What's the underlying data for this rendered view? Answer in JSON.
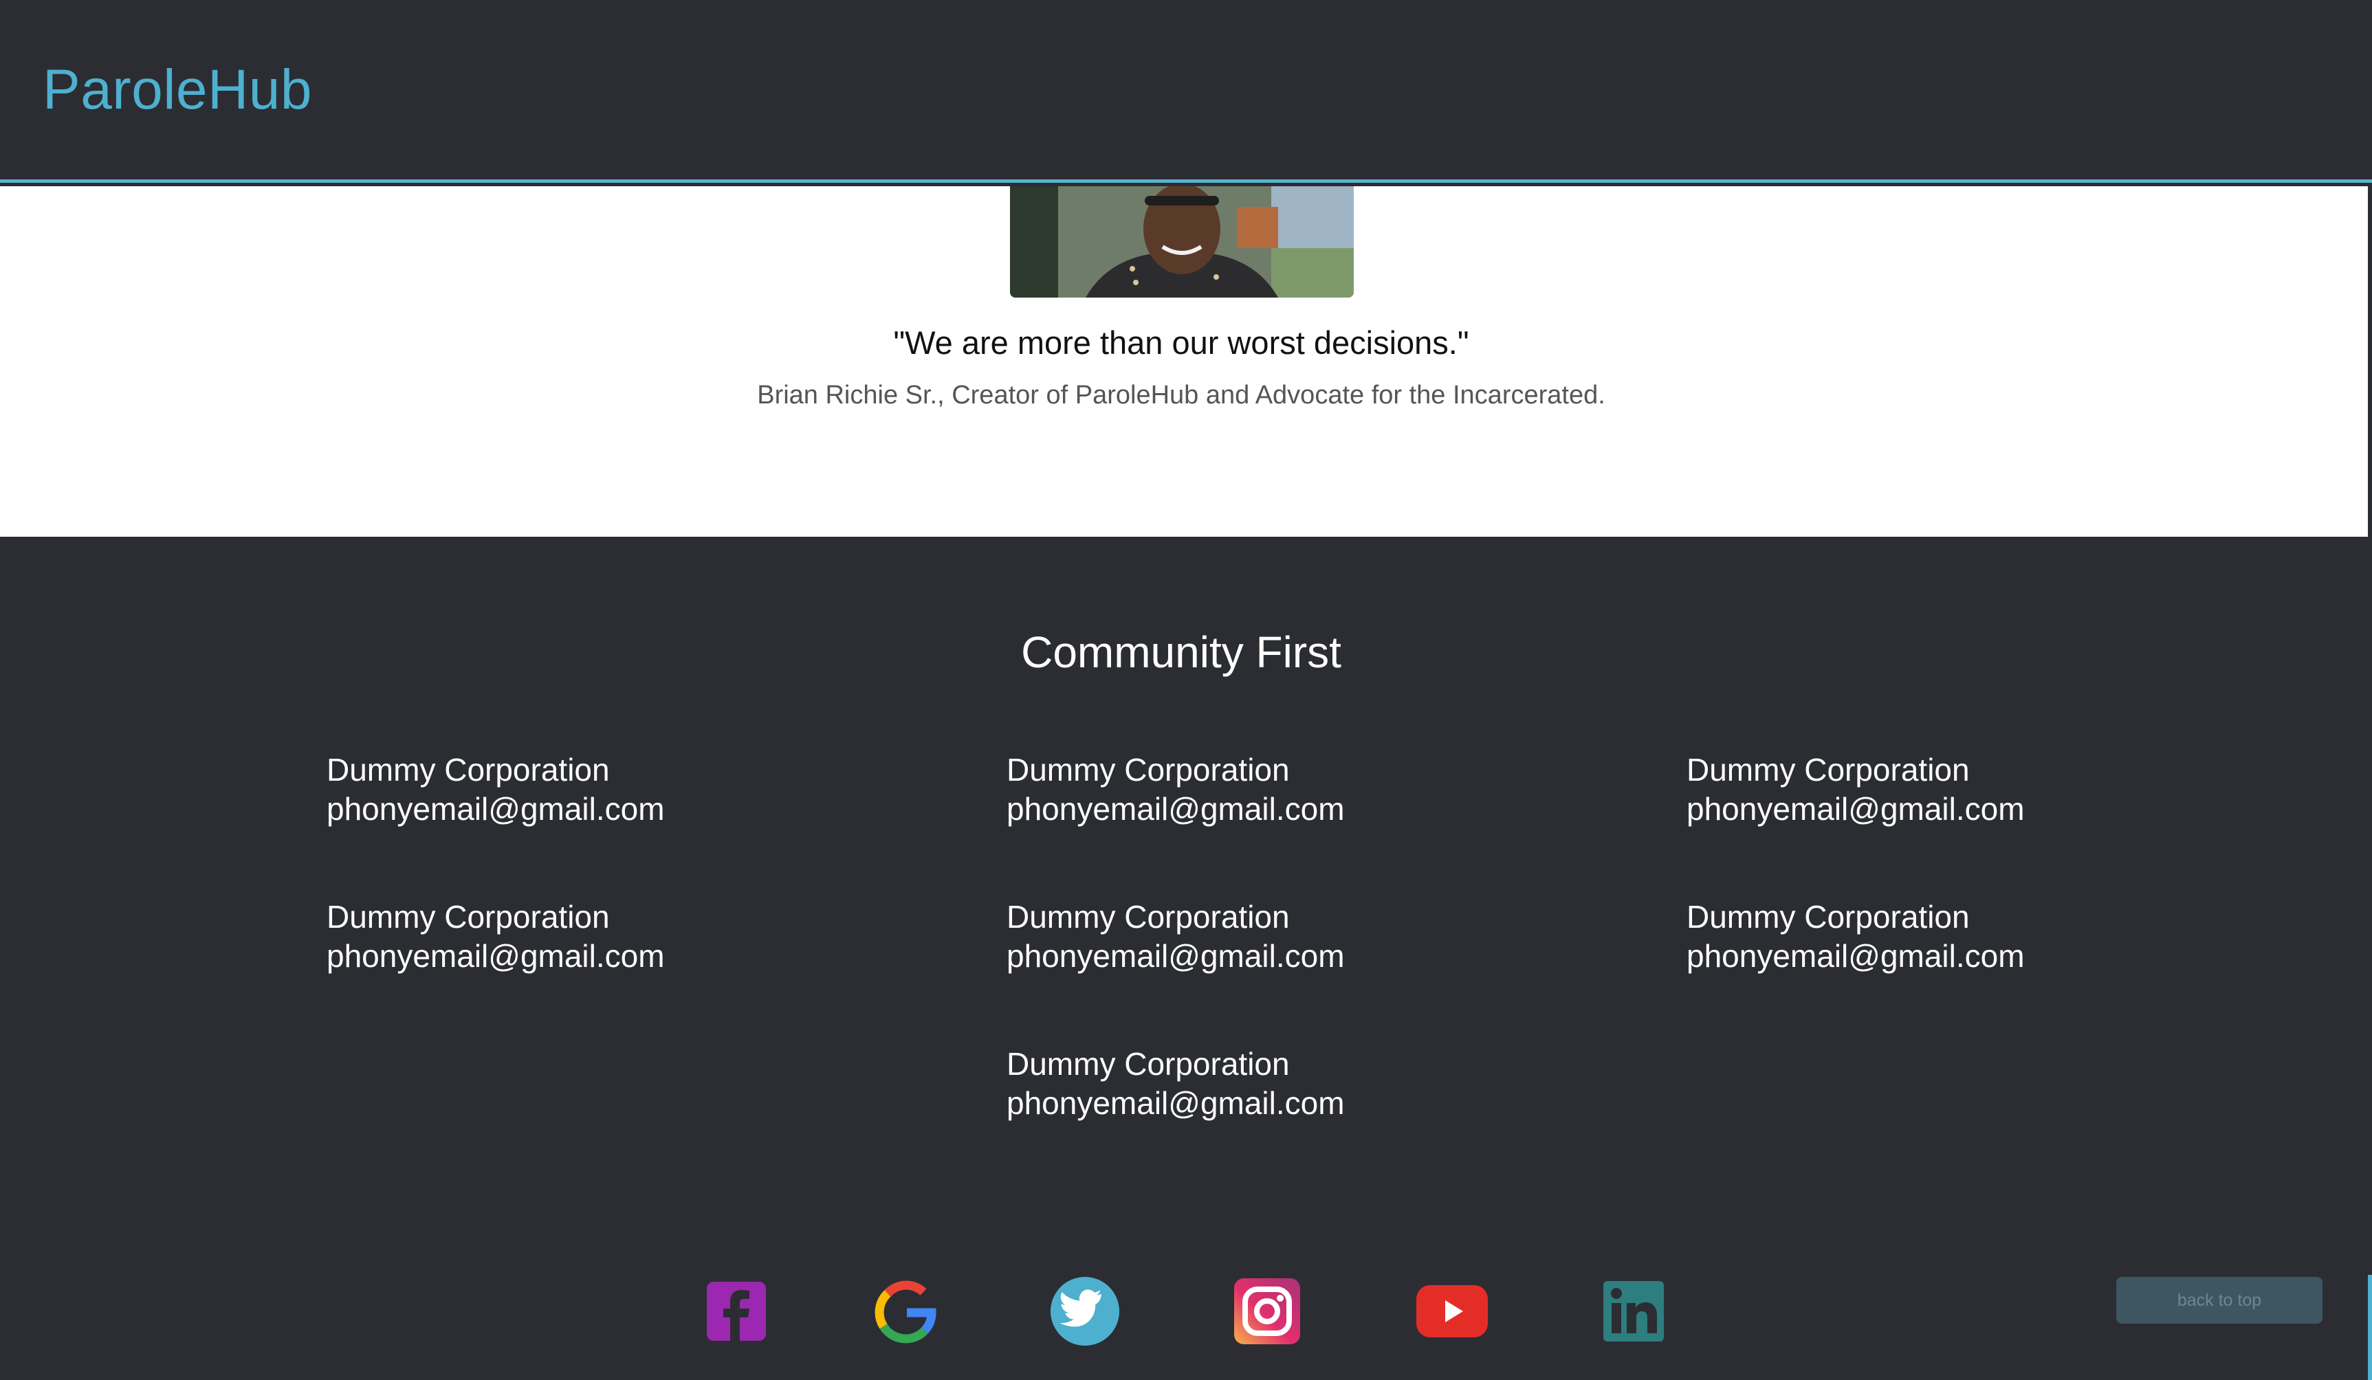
{
  "header": {
    "brand": "ParoleHub"
  },
  "hero": {
    "photo_alt": "Brian Richie Sr. portrait",
    "quote": "\"We are more than our worst decisions.\"",
    "attribution": "Brian Richie Sr., Creator of ParoleHub and Advocate for the Incarcerated."
  },
  "community": {
    "title": "Community First",
    "contacts": [
      {
        "name": "Dummy Corporation",
        "email": "phonyemail@gmail.com"
      },
      {
        "name": "Dummy Corporation",
        "email": "phonyemail@gmail.com"
      },
      {
        "name": "Dummy Corporation",
        "email": "phonyemail@gmail.com"
      },
      {
        "name": "Dummy Corporation",
        "email": "phonyemail@gmail.com"
      },
      {
        "name": "Dummy Corporation",
        "email": "phonyemail@gmail.com"
      },
      {
        "name": "Dummy Corporation",
        "email": "phonyemail@gmail.com"
      },
      {
        "name": "Dummy Corporation",
        "email": "phonyemail@gmail.com"
      }
    ]
  },
  "social": [
    {
      "icon": "facebook-icon",
      "color": "#9c27b0"
    },
    {
      "icon": "google-icon",
      "color": "#4285f4"
    },
    {
      "icon": "twitter-icon",
      "color": "#4eb0cf"
    },
    {
      "icon": "instagram-icon",
      "color": "#d6336c"
    },
    {
      "icon": "youtube-icon",
      "color": "#e52d27"
    },
    {
      "icon": "linkedin-icon",
      "color": "#2e7d7f"
    }
  ],
  "footer": {
    "back_to_top": "back to top"
  },
  "colors": {
    "background": "#2b2d33",
    "accent": "#4eb0cf",
    "hero_background": "#ffffff"
  }
}
